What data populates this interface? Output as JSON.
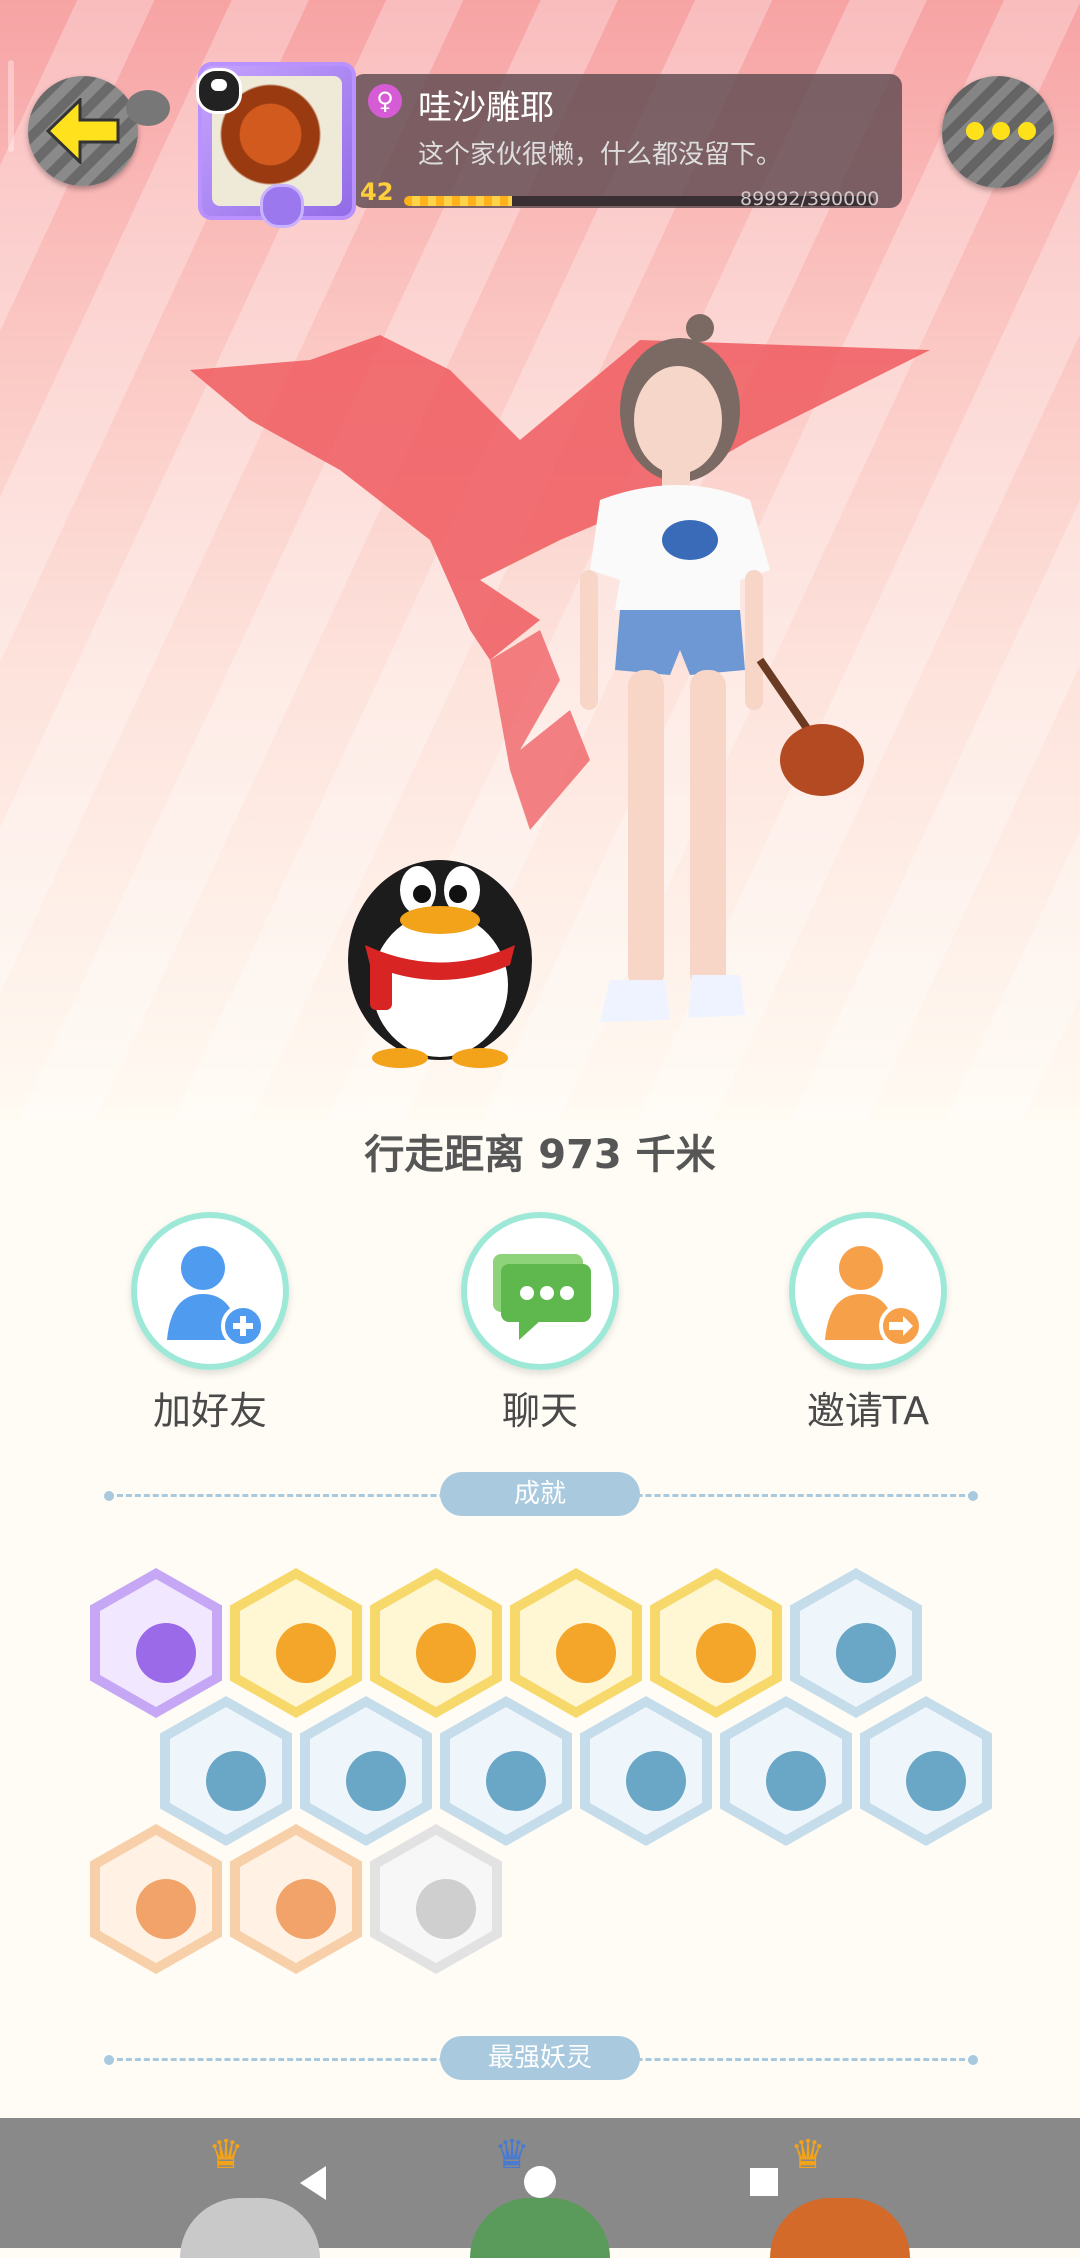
{
  "header": {
    "username": "哇沙雕耶",
    "bio": "这个家伙很懒，什么都没留下。",
    "level": "42",
    "xp": "89992/390000",
    "xp_fraction": 0.23,
    "gender_icon": "female-icon",
    "back_icon": "back-arrow-icon",
    "more_icon": "more-dots-icon"
  },
  "stats": {
    "walk_distance": "行走距离 973 千米"
  },
  "actions": [
    {
      "label": "加好友",
      "icon": "add-friend-icon",
      "color": "#4f9bf0"
    },
    {
      "label": "聊天",
      "icon": "chat-icon",
      "color": "#6ec45a"
    },
    {
      "label": "邀请TA",
      "icon": "invite-icon",
      "color": "#f6a14a"
    }
  ],
  "sections": {
    "achievements": "成就",
    "strongest_spirit": "最强妖灵"
  },
  "achievements": [
    {
      "icon": "purple-cat-icon",
      "tier": "purple"
    },
    {
      "icon": "sun-flower-icon",
      "tier": "gold"
    },
    {
      "icon": "gold-blob-icon",
      "tier": "gold"
    },
    {
      "icon": "yin-yang-comet-icon",
      "tier": "gold"
    },
    {
      "icon": "fox-spirit-icon",
      "tier": "gold"
    },
    {
      "icon": "sneaker-icon",
      "tier": "blue"
    },
    {
      "icon": "moon-icon",
      "tier": "blue"
    },
    {
      "icon": "crystal-icon",
      "tier": "blue"
    },
    {
      "icon": "spirit-figure-icon",
      "tier": "blue"
    },
    {
      "icon": "taichi-icon",
      "tier": "blue"
    },
    {
      "icon": "fish-dragon-icon",
      "tier": "blue"
    },
    {
      "icon": "portal-icon",
      "tier": "blue"
    },
    {
      "icon": "cat-cart-icon",
      "tier": "orange"
    },
    {
      "icon": "bull-icon",
      "tier": "orange"
    },
    {
      "icon": "wolf-book-icon",
      "tier": "grey"
    }
  ],
  "tiers": {
    "purple": {
      "outer": "#c6a7f5",
      "inner": "#f1e8ff",
      "motif": "#9b6ae8"
    },
    "gold": {
      "outer": "#f7d96b",
      "inner": "#fff6d4",
      "motif": "#f4a62a"
    },
    "blue": {
      "outer": "#c5dcea",
      "inner": "#eef6fb",
      "motif": "#6aa6c6"
    },
    "orange": {
      "outer": "#f7cfa8",
      "inner": "#fff1e3",
      "motif": "#f1a36a"
    },
    "grey": {
      "outer": "#e2e2e2",
      "inner": "#f7f7f7",
      "motif": "#cfcfcf"
    }
  },
  "system_nav": {
    "back": "nav-back-icon",
    "home": "nav-home-icon",
    "recents": "nav-recents-icon"
  }
}
